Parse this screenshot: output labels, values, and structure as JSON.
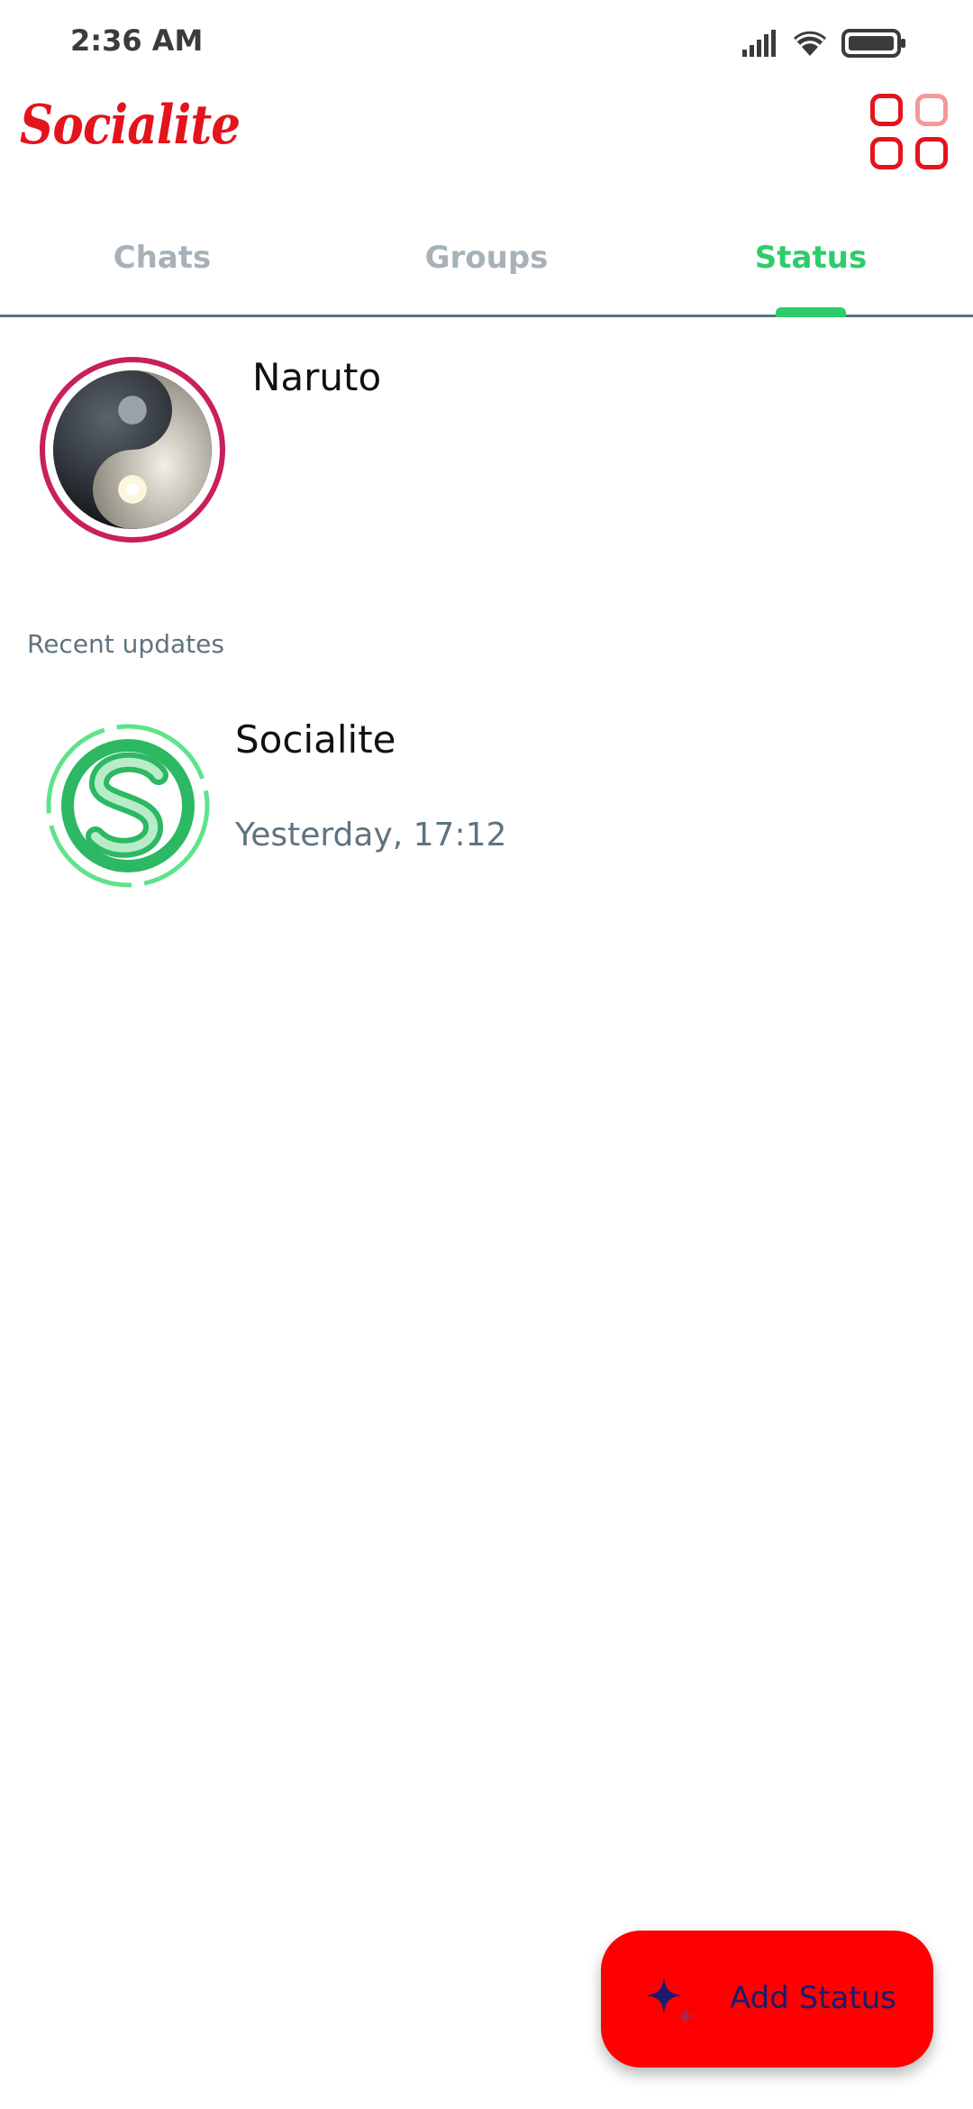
{
  "status_bar": {
    "time": "2:36 AM",
    "icons": [
      "signal-icon",
      "wifi-icon",
      "battery-icon"
    ]
  },
  "app": {
    "title": "Socialite",
    "menu_icon": "grid-icon"
  },
  "tabs": [
    {
      "label": "Chats",
      "active": false
    },
    {
      "label": "Groups",
      "active": false
    },
    {
      "label": "Status",
      "active": true
    }
  ],
  "my_status": {
    "name": "Naruto",
    "avatar": "yin-yang-avatar"
  },
  "recent": {
    "label": "Recent updates",
    "items": [
      {
        "name": "Socialite",
        "time": "Yesterday,  17:12",
        "avatar": "socialite-logo-avatar"
      }
    ]
  },
  "fab": {
    "label": "Add Status",
    "icon": "sparkle-icon"
  },
  "colors": {
    "brand_red": "#e3141c",
    "accent_green": "#2ecc6b",
    "status_ring": "#c91f5c",
    "fab_bg": "#ff0000",
    "muted_text": "#5f7380"
  }
}
